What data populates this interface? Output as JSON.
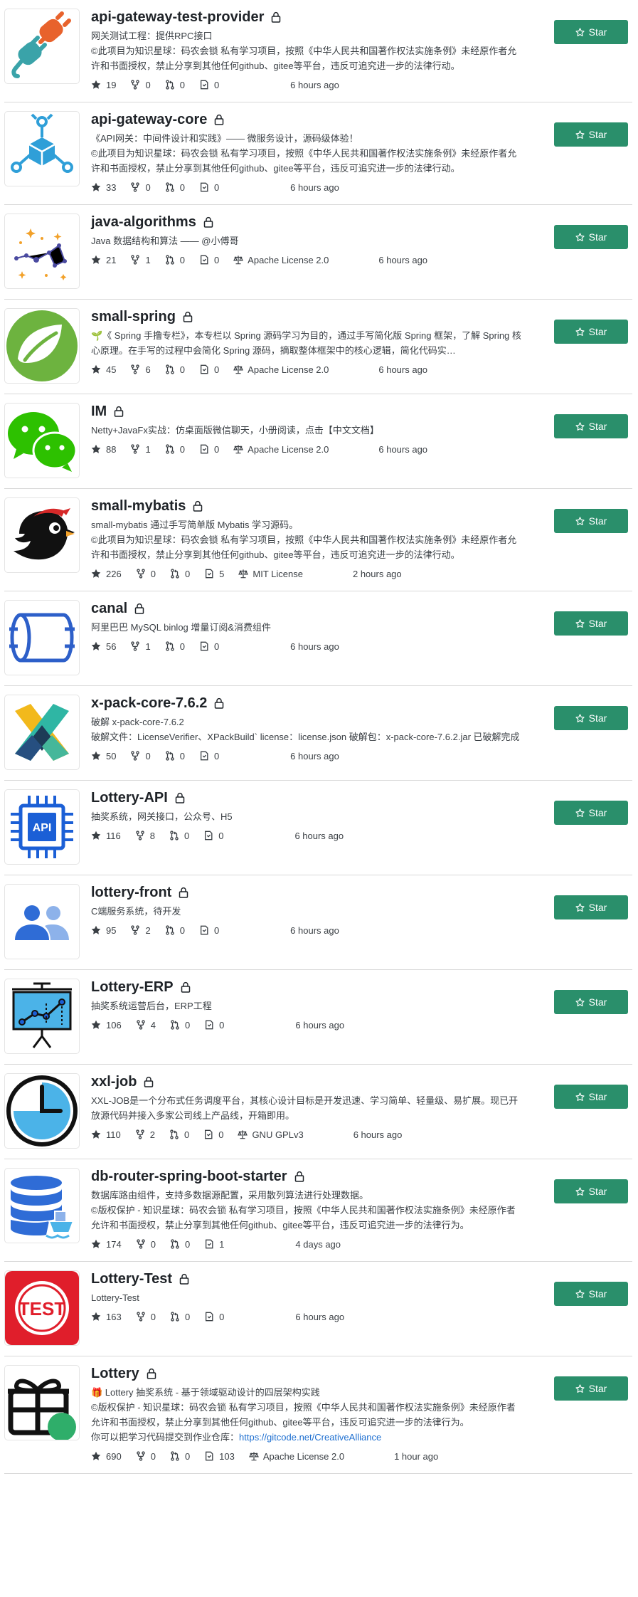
{
  "star_label": "Star",
  "colors": {
    "star_button": "#2a8f6b",
    "link": "#1e6fd0"
  },
  "repos": [
    {
      "name": "api-gateway-test-provider",
      "avatar": "plug-icon",
      "desc": [
        "网关测试工程：提供RPC接口",
        "©此项目为知识星球：码农会锁 私有学习项目，按照《中华人民共和国著作权法实施条例》未经原作者允许和书面授权，禁止分享到其他任何github、gitee等平台，违反可追究进一步的法律行动。"
      ],
      "stars": "19",
      "forks": "0",
      "prs": "0",
      "issues": "0",
      "license": "",
      "updated": "6 hours ago"
    },
    {
      "name": "api-gateway-core",
      "avatar": "cube-network-icon",
      "desc": [
        "《API网关：中间件设计和实践》—— 微服务设计，源码级体验！",
        "©此项目为知识星球：码农会锁 私有学习项目，按照《中华人民共和国著作权法实施条例》未经原作者允许和书面授权，禁止分享到其他任何github、gitee等平台，违反可追究进一步的法律行动。"
      ],
      "stars": "33",
      "forks": "0",
      "prs": "0",
      "issues": "0",
      "license": "",
      "updated": "6 hours ago"
    },
    {
      "name": "java-algorithms",
      "avatar": "constellation-icon",
      "desc": [
        "Java 数据结构和算法 —— @小傅哥"
      ],
      "stars": "21",
      "forks": "1",
      "prs": "0",
      "issues": "0",
      "license": "Apache License 2.0",
      "updated": "6 hours ago"
    },
    {
      "name": "small-spring",
      "avatar": "spring-leaf-icon",
      "desc": [
        "🌱《 Spring 手撸专栏》，本专栏以 Spring 源码学习为目的，通过手写简化版 Spring 框架，了解 Spring 核心原理。在手写的过程中会简化 Spring 源码，摘取整体框架中的核心逻辑，简化代码实…"
      ],
      "stars": "45",
      "forks": "6",
      "prs": "0",
      "issues": "0",
      "license": "Apache License 2.0",
      "updated": "6 hours ago"
    },
    {
      "name": "IM",
      "avatar": "wechat-icon",
      "desc": [
        "Netty+JavaFx实战：仿桌面版微信聊天，小册阅读，点击【中文文档】"
      ],
      "stars": "88",
      "forks": "1",
      "prs": "0",
      "issues": "0",
      "license": "Apache License 2.0",
      "updated": "6 hours ago"
    },
    {
      "name": "small-mybatis",
      "avatar": "ninja-bird-icon",
      "desc": [
        "small-mybatis 通过手写简单版 Mybatis 学习源码。",
        "©此项目为知识星球：码农会锁 私有学习项目，按照《中华人民共和国著作权法实施条例》未经原作者允许和书面授权，禁止分享到其他任何github、gitee等平台，违反可追究进一步的法律行动。"
      ],
      "stars": "226",
      "forks": "0",
      "prs": "0",
      "issues": "5",
      "license": "MIT License",
      "updated": "2 hours ago"
    },
    {
      "name": "canal",
      "avatar": "cylinder-icon",
      "desc": [
        "阿里巴巴 MySQL binlog 增量订阅&消费组件"
      ],
      "stars": "56",
      "forks": "1",
      "prs": "0",
      "issues": "0",
      "license": "",
      "updated": "6 hours ago"
    },
    {
      "name": "x-pack-core-7.6.2",
      "avatar": "x-cross-icon",
      "desc": [
        "破解 x-pack-core-7.6.2",
        "破解文件：LicenseVerifier、XPackBuild` license：license.json 破解包：x-pack-core-7.6.2.jar 已破解完成"
      ],
      "stars": "50",
      "forks": "0",
      "prs": "0",
      "issues": "0",
      "license": "",
      "updated": "6 hours ago"
    },
    {
      "name": "Lottery-API",
      "avatar": "api-chip-icon",
      "desc": [
        "抽奖系统，网关接口，公众号、H5"
      ],
      "stars": "116",
      "forks": "8",
      "prs": "0",
      "issues": "0",
      "license": "",
      "updated": "6 hours ago"
    },
    {
      "name": "lottery-front",
      "avatar": "users-icon",
      "desc": [
        "C端服务系统，待开发"
      ],
      "stars": "95",
      "forks": "2",
      "prs": "0",
      "issues": "0",
      "license": "",
      "updated": "6 hours ago"
    },
    {
      "name": "Lottery-ERP",
      "avatar": "presentation-chart-icon",
      "desc": [
        "抽奖系统运营后台，ERP工程"
      ],
      "stars": "106",
      "forks": "4",
      "prs": "0",
      "issues": "0",
      "license": "",
      "updated": "6 hours ago"
    },
    {
      "name": "xxl-job",
      "avatar": "clock-icon",
      "desc": [
        "XXL-JOB是一个分布式任务调度平台，其核心设计目标是开发迅速、学习简单、轻量级、易扩展。现已开放源代码并接入多家公司线上产品线，开箱即用。"
      ],
      "stars": "110",
      "forks": "2",
      "prs": "0",
      "issues": "0",
      "license": "GNU GPLv3",
      "updated": "6 hours ago"
    },
    {
      "name": "db-router-spring-boot-starter",
      "avatar": "database-ship-icon",
      "desc": [
        "数据库路由组件，支持多数据源配置，采用散列算法进行处理数据。",
        "©版权保护 - 知识星球：码农会锁 私有学习项目，按照《中华人民共和国著作权法实施条例》未经原作者允许和书面授权，禁止分享到其他任何github、gitee等平台，违反可追究进一步的法律行为。"
      ],
      "stars": "174",
      "forks": "0",
      "prs": "0",
      "issues": "1",
      "license": "",
      "updated": "4 days ago"
    },
    {
      "name": "Lottery-Test",
      "avatar": "test-stamp-icon",
      "desc": [
        "Lottery-Test"
      ],
      "stars": "163",
      "forks": "0",
      "prs": "0",
      "issues": "0",
      "license": "",
      "updated": "6 hours ago"
    },
    {
      "name": "Lottery",
      "avatar": "gift-icon",
      "desc": [
        "🎁 Lottery 抽奖系统 - 基于领域驱动设计的四层架构实践",
        "©版权保护 - 知识星球：码农会锁 私有学习项目，按照《中华人民共和国著作权法实施条例》未经原作者允许和书面授权，禁止分享到其他任何github、gitee等平台，违反可追究进一步的法律行为。"
      ],
      "desc_link_prefix": "你可以把学习代码提交到作业仓库：",
      "desc_link": "https://gitcode.net/CreativeAlliance",
      "stars": "690",
      "forks": "0",
      "prs": "0",
      "issues": "103",
      "license": "Apache License 2.0",
      "updated": "1 hour ago"
    }
  ]
}
